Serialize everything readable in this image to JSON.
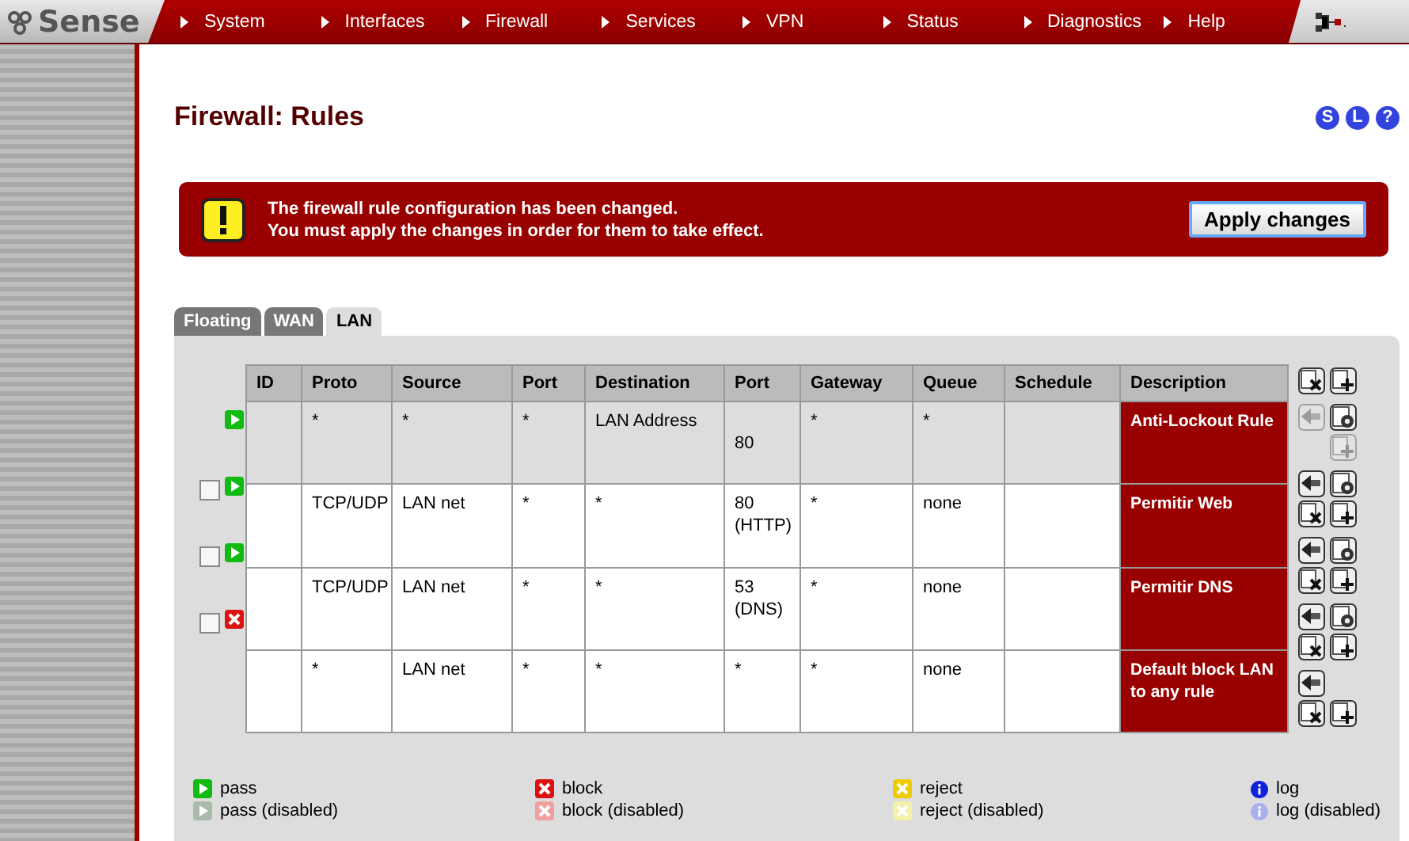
{
  "logo": {
    "text": "Sense"
  },
  "menu": [
    "System",
    "Interfaces",
    "Firewall",
    "Services",
    "VPN",
    "Status",
    "Diagnostics",
    "Help"
  ],
  "title": "Firewall: Rules",
  "header_links": [
    "S",
    "L",
    "?"
  ],
  "alert": {
    "lines": [
      "The firewall rule configuration has been changed.",
      "You must apply the changes in order for them to take effect."
    ],
    "button": "Apply changes"
  },
  "tabs": [
    {
      "label": "Floating",
      "selected": false
    },
    {
      "label": "WAN",
      "selected": false
    },
    {
      "label": "LAN",
      "selected": true
    }
  ],
  "table": {
    "columns": [
      "ID",
      "Proto",
      "Source",
      "Port",
      "Destination",
      "Port",
      "Gateway",
      "Queue",
      "Schedule",
      "Description"
    ],
    "rows": [
      {
        "kind": "pass",
        "locked": true,
        "cells": [
          "",
          "*",
          "*",
          "*",
          "LAN Address",
          "\n80",
          "*",
          "*",
          ""
        ],
        "description": "Anti-Lockout Rule"
      },
      {
        "kind": "pass",
        "locked": false,
        "checked": false,
        "cells": [
          "",
          "TCP/UDP",
          "LAN net",
          "*",
          "*",
          "80 (HTTP)",
          "*",
          "none",
          ""
        ],
        "description": "Permitir Web"
      },
      {
        "kind": "pass",
        "locked": false,
        "checked": false,
        "cells": [
          "",
          "TCP/UDP",
          "LAN net",
          "*",
          "*",
          "53 (DNS)",
          "*",
          "none",
          ""
        ],
        "description": "Permitir DNS"
      },
      {
        "kind": "block",
        "locked": false,
        "checked": false,
        "cells": [
          "",
          "*",
          "LAN net",
          "*",
          "*",
          "*",
          "*",
          "none",
          ""
        ],
        "description": "Default block LAN to any rule"
      }
    ]
  },
  "legend": [
    {
      "kind": "pass",
      "disabled": false,
      "label": "pass"
    },
    {
      "kind": "pass",
      "disabled": true,
      "label": "pass (disabled)"
    },
    {
      "kind": "block",
      "disabled": false,
      "label": "block"
    },
    {
      "kind": "block",
      "disabled": true,
      "label": "block (disabled)"
    },
    {
      "kind": "reject",
      "disabled": false,
      "label": "reject"
    },
    {
      "kind": "reject",
      "disabled": true,
      "label": "reject (disabled)"
    },
    {
      "kind": "log",
      "disabled": false,
      "label": "log"
    },
    {
      "kind": "log",
      "disabled": true,
      "label": "log (disabled)"
    }
  ]
}
